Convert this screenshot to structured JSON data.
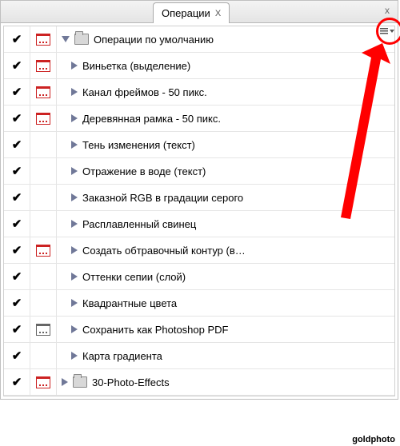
{
  "tab": {
    "title": "Операции",
    "close": "X"
  },
  "window": {
    "close": "x"
  },
  "rows": [
    {
      "check": true,
      "dialog": "red",
      "kind": "folder",
      "expanded": true,
      "indent": 0,
      "label": "Операции по умолчанию"
    },
    {
      "check": true,
      "dialog": "red",
      "kind": "item",
      "expanded": false,
      "indent": 1,
      "label": "Виньетка (выделение)"
    },
    {
      "check": true,
      "dialog": "red",
      "kind": "item",
      "expanded": false,
      "indent": 1,
      "label": "Канал фреймов - 50 пикс."
    },
    {
      "check": true,
      "dialog": "red",
      "kind": "item",
      "expanded": false,
      "indent": 1,
      "label": "Деревянная рамка - 50 пикс."
    },
    {
      "check": true,
      "dialog": "none",
      "kind": "item",
      "expanded": false,
      "indent": 1,
      "label": "Тень изменения (текст)"
    },
    {
      "check": true,
      "dialog": "none",
      "kind": "item",
      "expanded": false,
      "indent": 1,
      "label": "Отражение в воде (текст)"
    },
    {
      "check": true,
      "dialog": "none",
      "kind": "item",
      "expanded": false,
      "indent": 1,
      "label": "Заказной RGB в градации серого"
    },
    {
      "check": true,
      "dialog": "none",
      "kind": "item",
      "expanded": false,
      "indent": 1,
      "label": "Расплавленный свинец"
    },
    {
      "check": true,
      "dialog": "red",
      "kind": "item",
      "expanded": false,
      "indent": 1,
      "label": "Создать обтравочный контур (в…"
    },
    {
      "check": true,
      "dialog": "none",
      "kind": "item",
      "expanded": false,
      "indent": 1,
      "label": "Оттенки сепии (слой)"
    },
    {
      "check": true,
      "dialog": "none",
      "kind": "item",
      "expanded": false,
      "indent": 1,
      "label": "Квадрантные цвета"
    },
    {
      "check": true,
      "dialog": "gray",
      "kind": "item",
      "expanded": false,
      "indent": 1,
      "label": "Сохранить как Photoshop PDF"
    },
    {
      "check": true,
      "dialog": "none",
      "kind": "item",
      "expanded": false,
      "indent": 1,
      "label": "Карта градиента"
    },
    {
      "check": true,
      "dialog": "red",
      "kind": "folder",
      "expanded": false,
      "indent": 0,
      "label": "30-Photo-Effects"
    }
  ],
  "watermark": "goldphoto",
  "colors": {
    "accent": "#707898",
    "annotation": "#ff0000"
  }
}
